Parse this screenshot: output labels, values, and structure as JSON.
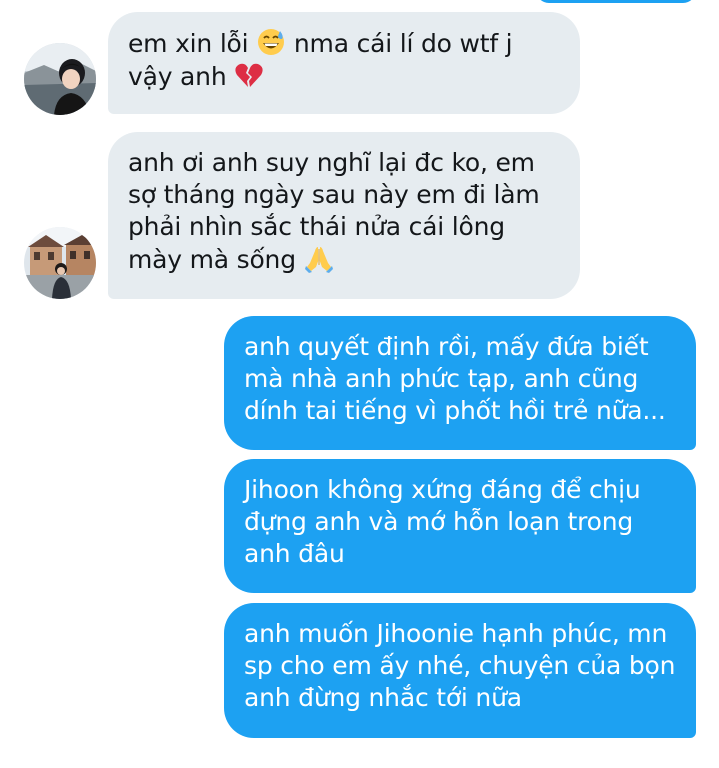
{
  "messages": [
    {
      "side": "received",
      "text": "em xin lỗi ",
      "text2": " nma cái lí do wtf j\nvậy anh ",
      "emoji": [
        "grinning-sweat-emoji",
        "broken-heart-emoji"
      ]
    },
    {
      "side": "received",
      "text": "anh ơi anh suy nghĩ lại đc ko, em\nsợ tháng ngày sau này em đi làm\nphải nhìn sắc thái nửa cái lông\nmày mà sống ",
      "emoji": [
        "folded-hands-emoji"
      ]
    },
    {
      "side": "sent",
      "text": "anh quyết định rồi, mấy đứa biết\nmà nhà anh phức tạp, anh cũng\ndính tai tiếng vì phốt hồi trẻ nữa..."
    },
    {
      "side": "sent",
      "text": "Jihoon không xứng đáng để chịu\nđựng anh và mớ hỗn loạn trong\nanh đâu"
    },
    {
      "side": "sent",
      "text": "anh muốn Jihoonie hạnh phúc, mn\nsp cho em ấy nhé, chuyện của bọn\nanh đừng nhắc tới nữa"
    }
  ],
  "colors": {
    "sent_bubble": "#1da1f2",
    "received_bubble": "#e6ecf0",
    "received_text": "#14171a"
  }
}
